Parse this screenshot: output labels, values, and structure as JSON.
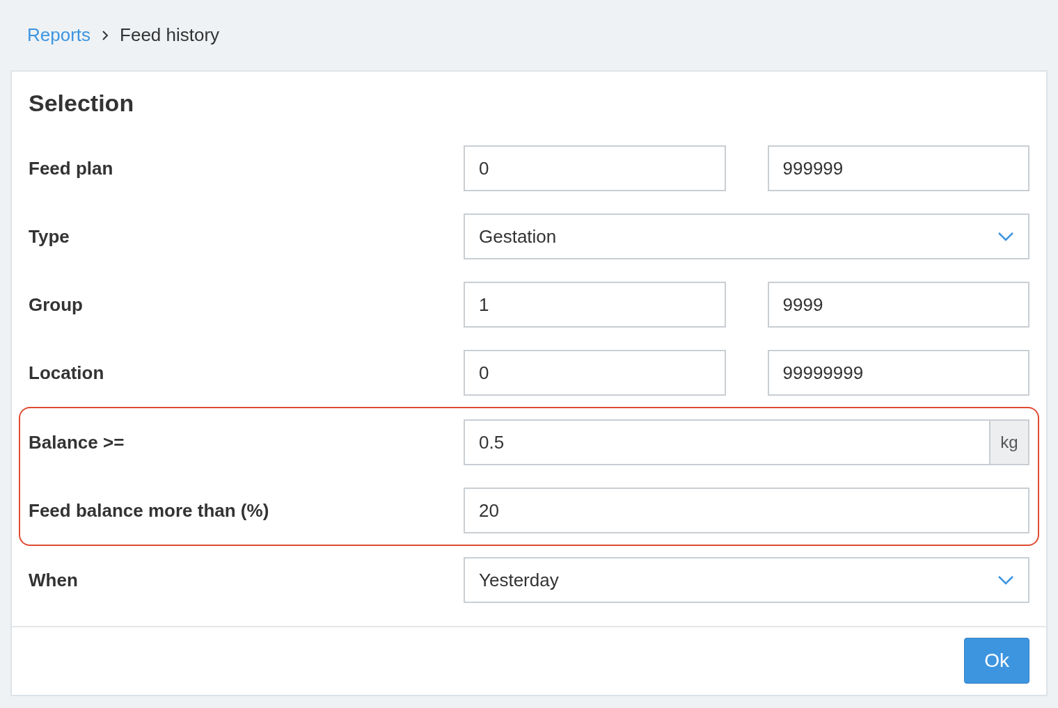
{
  "breadcrumb": [
    {
      "label": "Reports",
      "link": true
    },
    {
      "label": "Feed history",
      "link": false
    }
  ],
  "panel": {
    "title": "Selection",
    "rows": [
      {
        "kind": "range",
        "label": "Feed plan",
        "from": "0",
        "to": "999999",
        "highlighted": false
      },
      {
        "kind": "select",
        "label": "Type",
        "value": "Gestation",
        "highlighted": false
      },
      {
        "kind": "range",
        "label": "Group",
        "from": "1",
        "to": "9999",
        "highlighted": false
      },
      {
        "kind": "range",
        "label": "Location",
        "from": "0",
        "to": "99999999",
        "highlighted": false
      },
      {
        "kind": "unit",
        "label": "Balance >=",
        "value": "0.5",
        "unit": "kg",
        "highlighted": true
      },
      {
        "kind": "input",
        "label": "Feed balance more than (%)",
        "value": "20",
        "highlighted": true
      },
      {
        "kind": "select",
        "label": "When",
        "value": "Yesterday",
        "highlighted": false
      }
    ],
    "button": "Ok"
  }
}
